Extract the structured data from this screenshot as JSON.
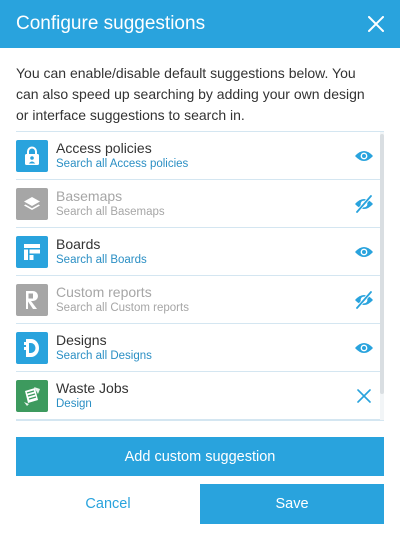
{
  "dialog": {
    "title": "Configure suggestions",
    "intro": "You can enable/disable default suggestions below. You can also speed up searching by adding your own design or interface suggestions to search in."
  },
  "colors": {
    "accent": "#29a3dd",
    "enabled_icon_bg": "#29a3dd",
    "disabled_icon_bg": "#a6a6a6",
    "custom_icon_bg": "#3d9a5e",
    "subtitle": "#2b8fc4",
    "disabled_text": "#a6a6a6"
  },
  "suggestions": [
    {
      "title": "Access policies",
      "subtitle": "Search all Access policies",
      "icon": "lock-person-icon",
      "enabled": true,
      "action": "eye-icon"
    },
    {
      "title": "Basemaps",
      "subtitle": "Search all Basemaps",
      "icon": "layers-icon",
      "enabled": false,
      "action": "eye-slash-icon"
    },
    {
      "title": "Boards",
      "subtitle": "Search all Boards",
      "icon": "board-icon",
      "enabled": true,
      "action": "eye-icon"
    },
    {
      "title": "Custom reports",
      "subtitle": "Search all Custom reports",
      "icon": "report-icon",
      "enabled": false,
      "action": "eye-slash-icon"
    },
    {
      "title": "Designs",
      "subtitle": "Search all Designs",
      "icon": "design-icon",
      "enabled": true,
      "action": "eye-icon"
    },
    {
      "title": "Waste Jobs",
      "subtitle": "Design",
      "icon": "waste-jobs-icon",
      "enabled": true,
      "action": "remove-icon"
    }
  ],
  "buttons": {
    "add_custom": "Add custom suggestion",
    "cancel": "Cancel",
    "save": "Save"
  }
}
